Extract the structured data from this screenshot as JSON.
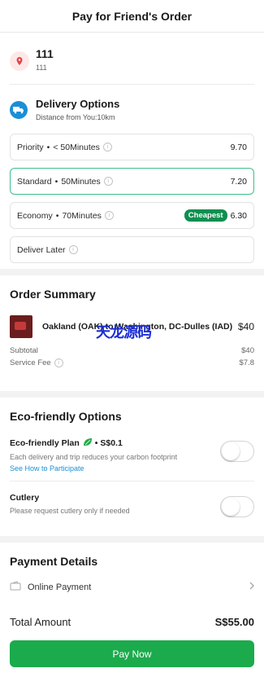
{
  "header": {
    "title": "Pay for Friend's Order"
  },
  "location": {
    "name": "111",
    "sub": "111",
    "icon": "location-pin-icon"
  },
  "delivery": {
    "title": "Delivery Options",
    "distance": "Distance from You:10km",
    "icon": "delivery-truck-icon",
    "options": [
      {
        "name": "Priority",
        "time": "< 50Minutes",
        "price": "9.70",
        "badge": ""
      },
      {
        "name": "Standard",
        "time": "50Minutes",
        "price": "7.20",
        "badge": ""
      },
      {
        "name": "Economy",
        "time": "70Minutes",
        "price": "6.30",
        "badge": "Cheapest"
      }
    ],
    "later_label": "Deliver Later",
    "separator": "•",
    "selected": "Standard"
  },
  "order_summary": {
    "title": "Order Summary",
    "item_name": "Oakland (OAK) to Washington, DC-Dulles (IAD)",
    "item_price": "$40",
    "subtotal_label": "Subtotal",
    "subtotal_value": "$40",
    "service_fee_label": "Service Fee",
    "service_fee_value": "$7.8"
  },
  "watermark": "天龙源码",
  "eco": {
    "title": "Eco-friendly Options",
    "plan_label": "Eco-friendly Plan",
    "plan_price": "• S$0.1",
    "plan_desc": "Each delivery and trip reduces your carbon footprint",
    "plan_link": "See How to Participate",
    "cutlery_label": "Cutlery",
    "cutlery_desc": "Please request cutlery only if needed",
    "plan_enabled": false,
    "cutlery_enabled": false
  },
  "payment": {
    "title": "Payment Details",
    "method": "Online Payment"
  },
  "footer": {
    "total_label": "Total Amount",
    "total_value": "S$55.00",
    "pay_button": "Pay Now"
  },
  "colors": {
    "accent_green": "#1bab4c",
    "badge_green": "#0e8f4f",
    "link_blue": "#1a8fd6",
    "pin_red": "#e0474c"
  }
}
